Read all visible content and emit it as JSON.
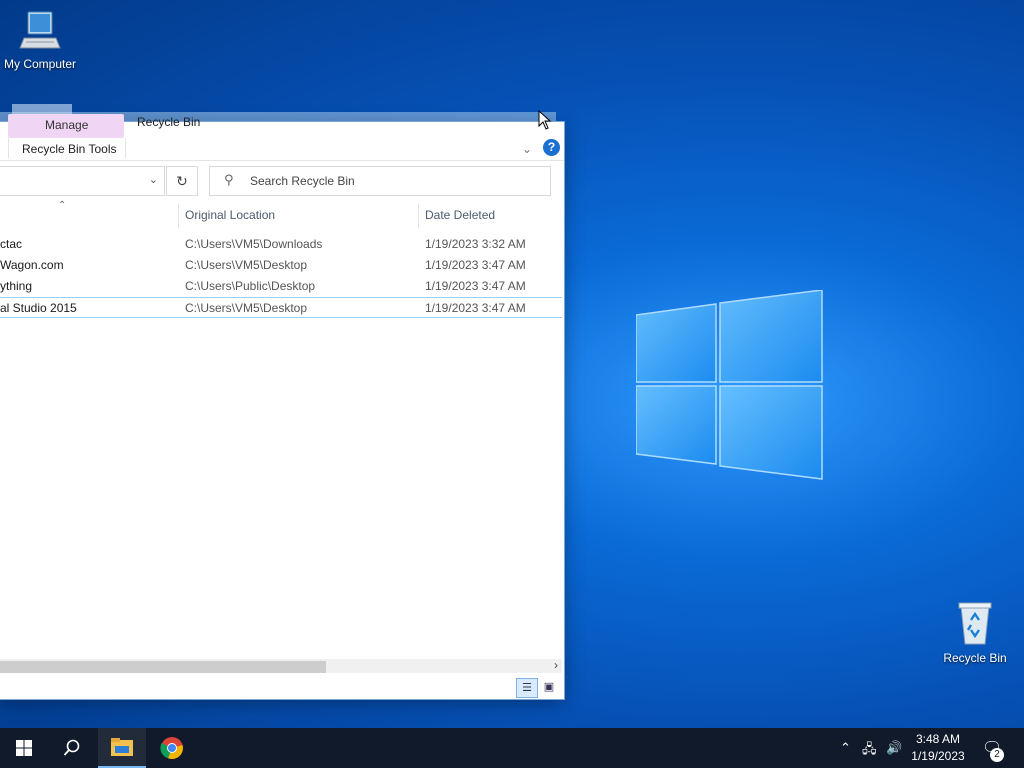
{
  "desktop": {
    "icons": [
      {
        "label": "My Computer",
        "icon": "computer-icon"
      },
      {
        "label": "Recycle Bin",
        "icon": "recycle-bin-icon"
      }
    ]
  },
  "window": {
    "title": "Recycle Bin",
    "ribbon": {
      "context_tab": "Manage",
      "tools_label": "Recycle Bin Tools"
    },
    "search": {
      "placeholder": "Search Recycle Bin"
    },
    "columns": [
      "Original Location",
      "Date Deleted"
    ],
    "rows": [
      {
        "name": "ctac",
        "location": "C:\\Users\\VM5\\Downloads",
        "date": "1/19/2023 3:32 AM",
        "selected": false
      },
      {
        "name": "Wagon.com",
        "location": "C:\\Users\\VM5\\Desktop",
        "date": "1/19/2023 3:47 AM",
        "selected": false
      },
      {
        "name": "ything",
        "location": "C:\\Users\\Public\\Desktop",
        "date": "1/19/2023 3:47 AM",
        "selected": false
      },
      {
        "name": "al Studio 2015",
        "location": "C:\\Users\\VM5\\Desktop",
        "date": "1/19/2023 3:47 AM",
        "selected": true
      }
    ]
  },
  "taskbar": {
    "pinned": [
      "windows-start-icon",
      "search-icon",
      "file-explorer-icon",
      "chrome-icon"
    ],
    "clock": {
      "time": "3:48 AM",
      "date": "1/19/2023"
    },
    "notifications_count": "2"
  },
  "colors": {
    "accent": "#1a6fd0",
    "selection_border": "#99d1ff",
    "taskbar": "#101a2a"
  }
}
